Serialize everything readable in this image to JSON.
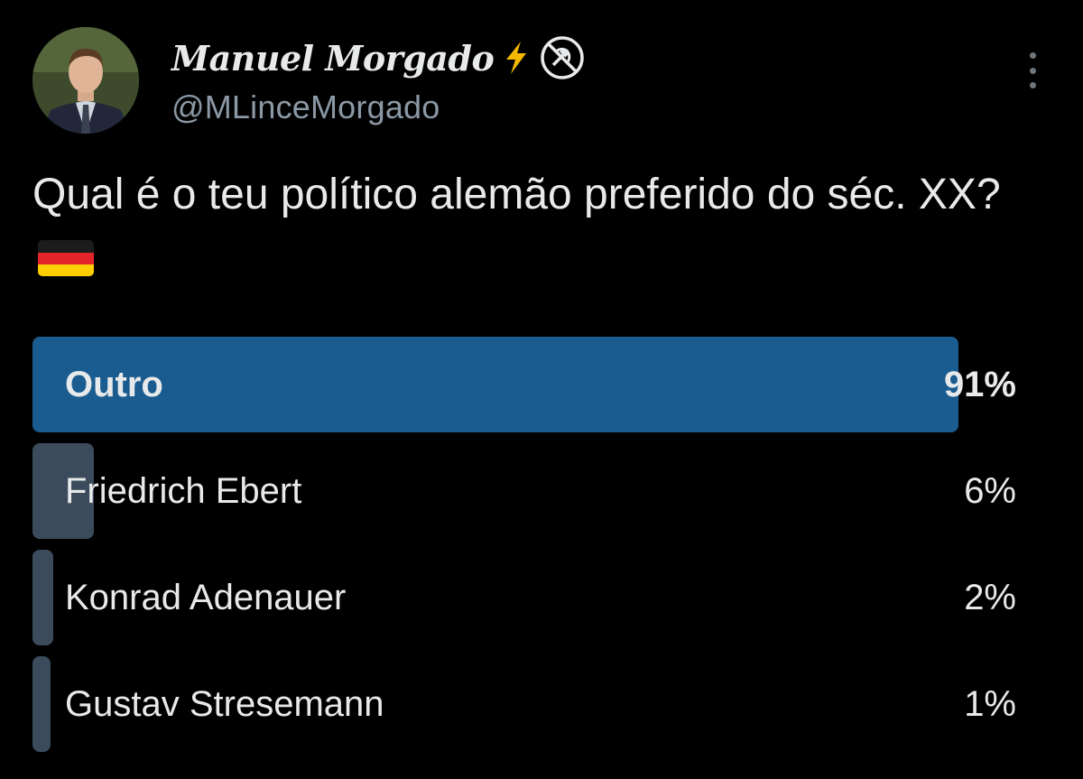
{
  "author": {
    "display_name": "Manuel Morgado",
    "handle": "@MLinceMorgado",
    "avatar_icon": "profile-photo-icon",
    "badges": [
      "lightning-bolt-icon",
      "prohibited-hammer-sickle-icon"
    ]
  },
  "tweet": {
    "text": "Qual é o teu político alemão preferido do séc. XX?",
    "flag_icon": "german-flag-icon"
  },
  "menu": {
    "icon": "more-vertical-icon"
  },
  "colors": {
    "background": "#000000",
    "text": "#e7e9ea",
    "secondary_text": "#8b98a5",
    "winner_bar": "#1a5c8f",
    "option_bar": "#3b4b5b"
  },
  "poll": {
    "options": [
      {
        "label": "Outro",
        "percent_label": "91%",
        "percent": 91,
        "winner": true
      },
      {
        "label": "Friedrich Ebert",
        "percent_label": "6%",
        "percent": 6,
        "winner": false
      },
      {
        "label": "Konrad Adenauer",
        "percent_label": "2%",
        "percent": 2,
        "winner": false
      },
      {
        "label": "Gustav Stresemann",
        "percent_label": "1%",
        "percent": 1,
        "winner": false
      }
    ]
  }
}
